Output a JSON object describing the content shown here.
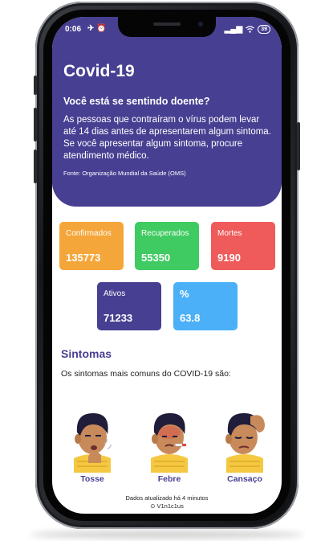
{
  "status_bar": {
    "time": "0:06",
    "left_icons": "✈ ⏰",
    "signal": "▂▄▆",
    "battery": "39"
  },
  "header": {
    "title": "Covid-19",
    "question": "Você está se sentindo doente?",
    "description": "As pessoas que contraíram o vírus podem levar até 14 dias antes de apresentarem algum sintoma. Se você apresentar algum sintoma, procure atendimento médico.",
    "source": "Fonte: Organização Mundial da Saúde (OMS)"
  },
  "stats": [
    {
      "label": "Confirmados",
      "value": "135773",
      "color": "#f4a63a"
    },
    {
      "label": "Recuperados",
      "value": "55350",
      "color": "#3fcb61"
    },
    {
      "label": "Mortes",
      "value": "9190",
      "color": "#ef5a5a"
    },
    {
      "label": "Ativos",
      "value": "71233",
      "color": "#473f91"
    },
    {
      "label": "%",
      "value": "63.8",
      "color": "#4bb0f7"
    }
  ],
  "symptoms": {
    "title": "Sintomas",
    "description": "Os sintomas mais comuns do COVID-19 são:",
    "items": [
      {
        "label": "Tosse",
        "icon": "cough-person-icon"
      },
      {
        "label": "Febre",
        "icon": "fever-person-icon"
      },
      {
        "label": "Cansaço",
        "icon": "tired-person-icon"
      }
    ]
  },
  "footer": {
    "updated": "Dados atualizado há 4 minutos",
    "author": "V1n1c1us"
  },
  "colors": {
    "primary": "#473f91",
    "scarf": "#f5c842",
    "skin": "#c88a5a",
    "hair": "#1f1d3a"
  }
}
